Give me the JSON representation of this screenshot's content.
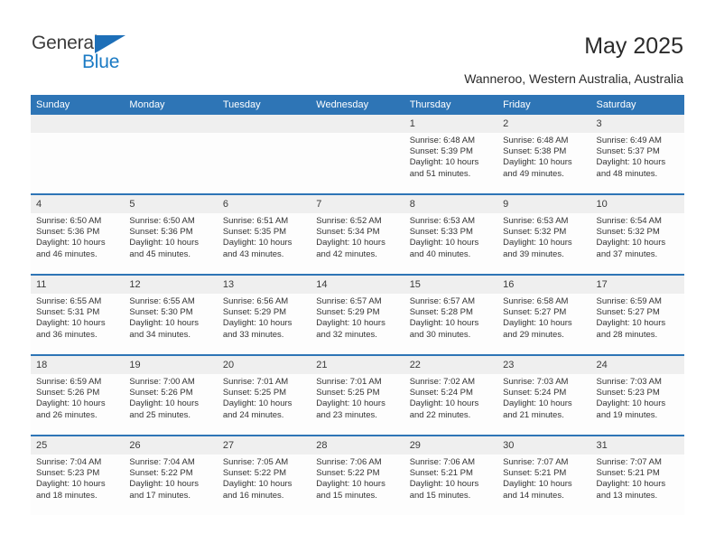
{
  "logo": {
    "word1": "General",
    "word2": "Blue",
    "triangle_icon": "blue-triangle-icon",
    "color_dark": "#3d3d3d",
    "color_blue": "#1a7ac4"
  },
  "header": {
    "title": "May 2025",
    "subtitle": "Wanneroo, Western Australia, Australia"
  },
  "colors": {
    "header_blue": "#2e75b6",
    "daynum_band": "#efefef",
    "cell_body": "#fdfdfd"
  },
  "calendar": {
    "weekday_headers": [
      "Sunday",
      "Monday",
      "Tuesday",
      "Wednesday",
      "Thursday",
      "Friday",
      "Saturday"
    ],
    "weeks": [
      {
        "days": [
          {
            "num": "",
            "detail": ""
          },
          {
            "num": "",
            "detail": ""
          },
          {
            "num": "",
            "detail": ""
          },
          {
            "num": "",
            "detail": ""
          },
          {
            "num": "1",
            "detail": "Sunrise: 6:48 AM\nSunset: 5:39 PM\nDaylight: 10 hours\nand 51 minutes."
          },
          {
            "num": "2",
            "detail": "Sunrise: 6:48 AM\nSunset: 5:38 PM\nDaylight: 10 hours\nand 49 minutes."
          },
          {
            "num": "3",
            "detail": "Sunrise: 6:49 AM\nSunset: 5:37 PM\nDaylight: 10 hours\nand 48 minutes."
          }
        ]
      },
      {
        "days": [
          {
            "num": "4",
            "detail": "Sunrise: 6:50 AM\nSunset: 5:36 PM\nDaylight: 10 hours\nand 46 minutes."
          },
          {
            "num": "5",
            "detail": "Sunrise: 6:50 AM\nSunset: 5:36 PM\nDaylight: 10 hours\nand 45 minutes."
          },
          {
            "num": "6",
            "detail": "Sunrise: 6:51 AM\nSunset: 5:35 PM\nDaylight: 10 hours\nand 43 minutes."
          },
          {
            "num": "7",
            "detail": "Sunrise: 6:52 AM\nSunset: 5:34 PM\nDaylight: 10 hours\nand 42 minutes."
          },
          {
            "num": "8",
            "detail": "Sunrise: 6:53 AM\nSunset: 5:33 PM\nDaylight: 10 hours\nand 40 minutes."
          },
          {
            "num": "9",
            "detail": "Sunrise: 6:53 AM\nSunset: 5:32 PM\nDaylight: 10 hours\nand 39 minutes."
          },
          {
            "num": "10",
            "detail": "Sunrise: 6:54 AM\nSunset: 5:32 PM\nDaylight: 10 hours\nand 37 minutes."
          }
        ]
      },
      {
        "days": [
          {
            "num": "11",
            "detail": "Sunrise: 6:55 AM\nSunset: 5:31 PM\nDaylight: 10 hours\nand 36 minutes."
          },
          {
            "num": "12",
            "detail": "Sunrise: 6:55 AM\nSunset: 5:30 PM\nDaylight: 10 hours\nand 34 minutes."
          },
          {
            "num": "13",
            "detail": "Sunrise: 6:56 AM\nSunset: 5:29 PM\nDaylight: 10 hours\nand 33 minutes."
          },
          {
            "num": "14",
            "detail": "Sunrise: 6:57 AM\nSunset: 5:29 PM\nDaylight: 10 hours\nand 32 minutes."
          },
          {
            "num": "15",
            "detail": "Sunrise: 6:57 AM\nSunset: 5:28 PM\nDaylight: 10 hours\nand 30 minutes."
          },
          {
            "num": "16",
            "detail": "Sunrise: 6:58 AM\nSunset: 5:27 PM\nDaylight: 10 hours\nand 29 minutes."
          },
          {
            "num": "17",
            "detail": "Sunrise: 6:59 AM\nSunset: 5:27 PM\nDaylight: 10 hours\nand 28 minutes."
          }
        ]
      },
      {
        "days": [
          {
            "num": "18",
            "detail": "Sunrise: 6:59 AM\nSunset: 5:26 PM\nDaylight: 10 hours\nand 26 minutes."
          },
          {
            "num": "19",
            "detail": "Sunrise: 7:00 AM\nSunset: 5:26 PM\nDaylight: 10 hours\nand 25 minutes."
          },
          {
            "num": "20",
            "detail": "Sunrise: 7:01 AM\nSunset: 5:25 PM\nDaylight: 10 hours\nand 24 minutes."
          },
          {
            "num": "21",
            "detail": "Sunrise: 7:01 AM\nSunset: 5:25 PM\nDaylight: 10 hours\nand 23 minutes."
          },
          {
            "num": "22",
            "detail": "Sunrise: 7:02 AM\nSunset: 5:24 PM\nDaylight: 10 hours\nand 22 minutes."
          },
          {
            "num": "23",
            "detail": "Sunrise: 7:03 AM\nSunset: 5:24 PM\nDaylight: 10 hours\nand 21 minutes."
          },
          {
            "num": "24",
            "detail": "Sunrise: 7:03 AM\nSunset: 5:23 PM\nDaylight: 10 hours\nand 19 minutes."
          }
        ]
      },
      {
        "days": [
          {
            "num": "25",
            "detail": "Sunrise: 7:04 AM\nSunset: 5:23 PM\nDaylight: 10 hours\nand 18 minutes."
          },
          {
            "num": "26",
            "detail": "Sunrise: 7:04 AM\nSunset: 5:22 PM\nDaylight: 10 hours\nand 17 minutes."
          },
          {
            "num": "27",
            "detail": "Sunrise: 7:05 AM\nSunset: 5:22 PM\nDaylight: 10 hours\nand 16 minutes."
          },
          {
            "num": "28",
            "detail": "Sunrise: 7:06 AM\nSunset: 5:22 PM\nDaylight: 10 hours\nand 15 minutes."
          },
          {
            "num": "29",
            "detail": "Sunrise: 7:06 AM\nSunset: 5:21 PM\nDaylight: 10 hours\nand 15 minutes."
          },
          {
            "num": "30",
            "detail": "Sunrise: 7:07 AM\nSunset: 5:21 PM\nDaylight: 10 hours\nand 14 minutes."
          },
          {
            "num": "31",
            "detail": "Sunrise: 7:07 AM\nSunset: 5:21 PM\nDaylight: 10 hours\nand 13 minutes."
          }
        ]
      }
    ]
  }
}
